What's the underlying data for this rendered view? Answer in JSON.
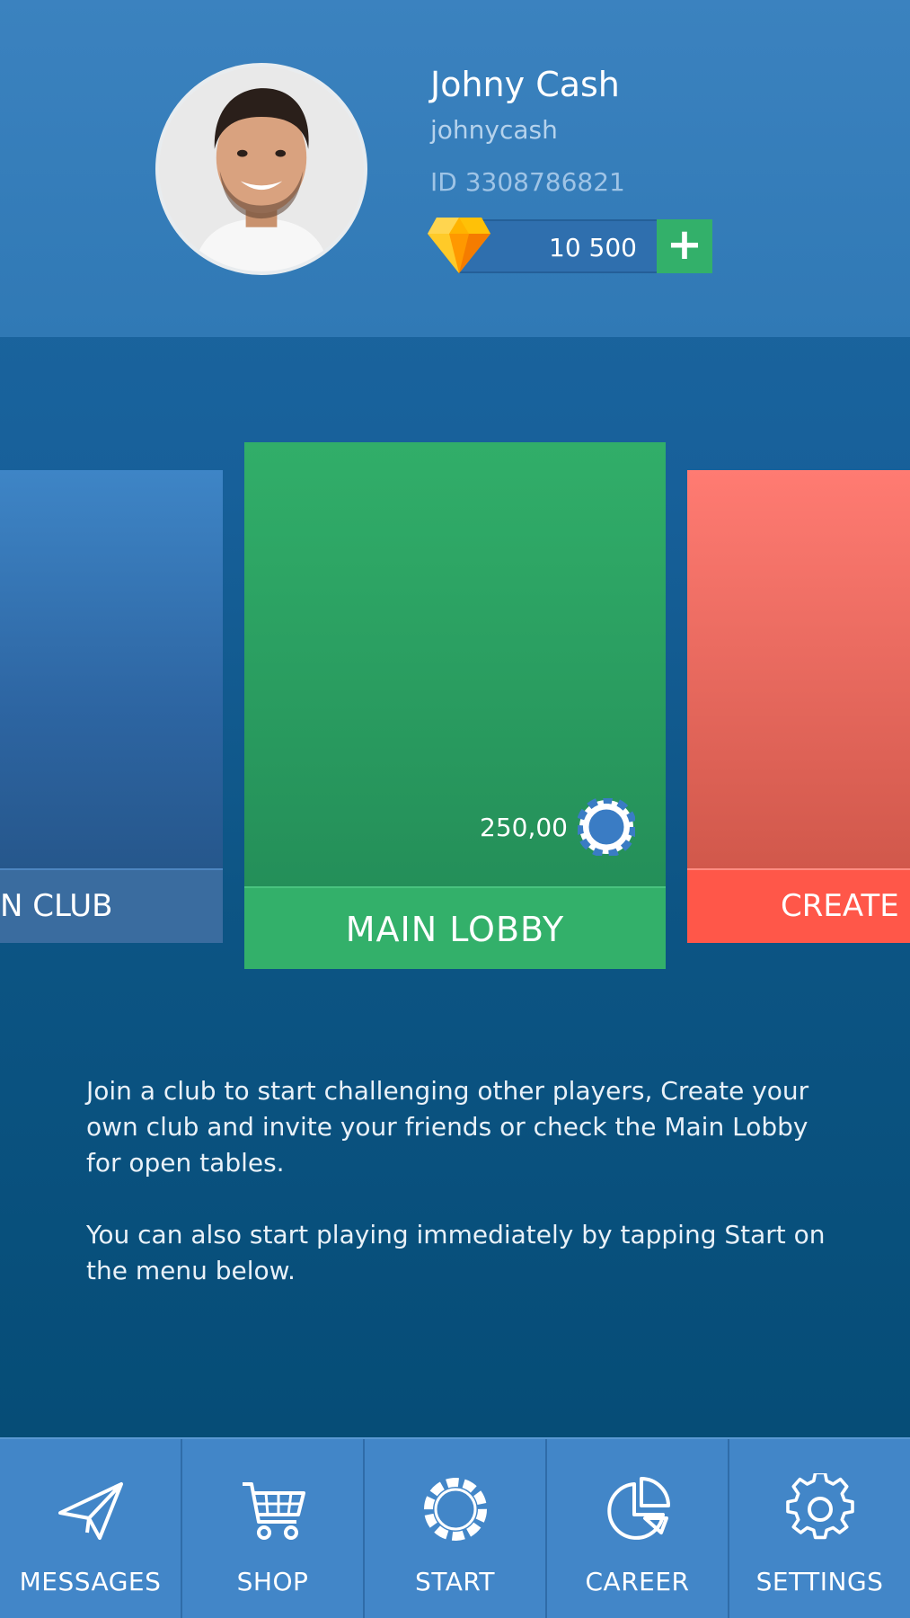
{
  "profile": {
    "name": "Johny Cash",
    "username": "johnycash",
    "id_text": "ID 3308786821",
    "gems": "10 500",
    "add_label": "+"
  },
  "cards": {
    "left": {
      "label": "N CLUB"
    },
    "main": {
      "label": "MAIN LOBBY",
      "amount": "250,00"
    },
    "right": {
      "label": "CREATE C"
    }
  },
  "info": {
    "paragraph1": "Join a club to start challenging other players, Create your own club and invite your friends or check the Main Lobby for open tables.",
    "paragraph2": "You can also start playing immediately by tapping Start on the menu below."
  },
  "nav": {
    "items": [
      {
        "label": "MESSAGES",
        "icon": "paper-plane-icon"
      },
      {
        "label": "SHOP",
        "icon": "cart-icon"
      },
      {
        "label": "START",
        "icon": "poker-chip-icon"
      },
      {
        "label": "CAREER",
        "icon": "pie-chart-icon"
      },
      {
        "label": "SETTINGS",
        "icon": "gear-icon"
      }
    ]
  },
  "colors": {
    "accent_green": "#33b06a",
    "accent_red": "#ff5749",
    "nav_blue": "#4286c8"
  }
}
